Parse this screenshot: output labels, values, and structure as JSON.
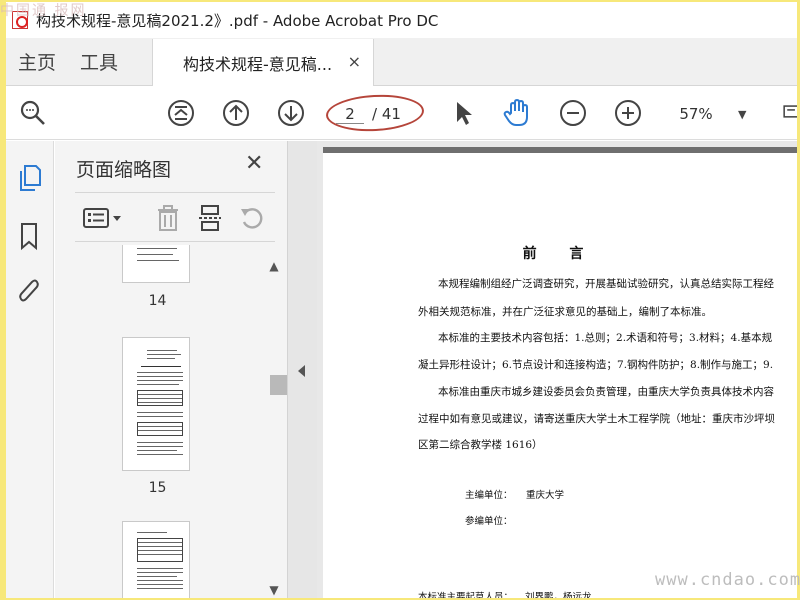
{
  "window": {
    "title": "构技术规程-意见稿2021.2》.pdf - Adobe Acrobat Pro DC",
    "watermark_top_left": "中国通 报网"
  },
  "tabs": {
    "home": "主页",
    "tools": "工具",
    "document": "构技术规程-意见稿...",
    "close_glyph": "×"
  },
  "toolbar": {
    "current_page": "2",
    "total_pages": "/ 41",
    "zoom": "57%",
    "zoom_caret": "▼"
  },
  "thumbnail_panel": {
    "title": "页面缩略图",
    "close_glyph": "✕",
    "pages": [
      {
        "label": "14"
      },
      {
        "label": "15"
      }
    ]
  },
  "document": {
    "heading": "前 言",
    "lines": [
      "本规程编制组经广泛调查研究，开展基础试验研究，认真总结实际工程经",
      "外相关规范标准，并在广泛征求意见的基础上，编制了本标准。",
      "本标准的主要技术内容包括：1.总则；2.术语和符号；3.材料；4.基本规",
      "凝土异形柱设计；6.节点设计和连接构造；7.钢构件防护；8.制作与施工；9.",
      "本标准由重庆市城乡建设委员会负责管理，由重庆大学负责具体技术内容",
      "过程中如有意见或建议，请寄送重庆大学土木工程学院（地址：重庆市沙坪坝",
      "区第二综合教学楼 1616）"
    ],
    "chief_unit_label": "主编单位：",
    "chief_unit_value": "重庆大学",
    "participating_unit_label": "参编单位：",
    "drafters_label": "本标准主要起草人员：",
    "drafters_value": "刘界鹏，杨远龙"
  },
  "watermark_bottom_right": "www.cndao.com",
  "colors": {
    "frame_border": "#f7e87a",
    "highlight_ellipse": "#b5453a",
    "hand_tool": "#2d7bd2",
    "active_rail": "#2d7bd2"
  }
}
